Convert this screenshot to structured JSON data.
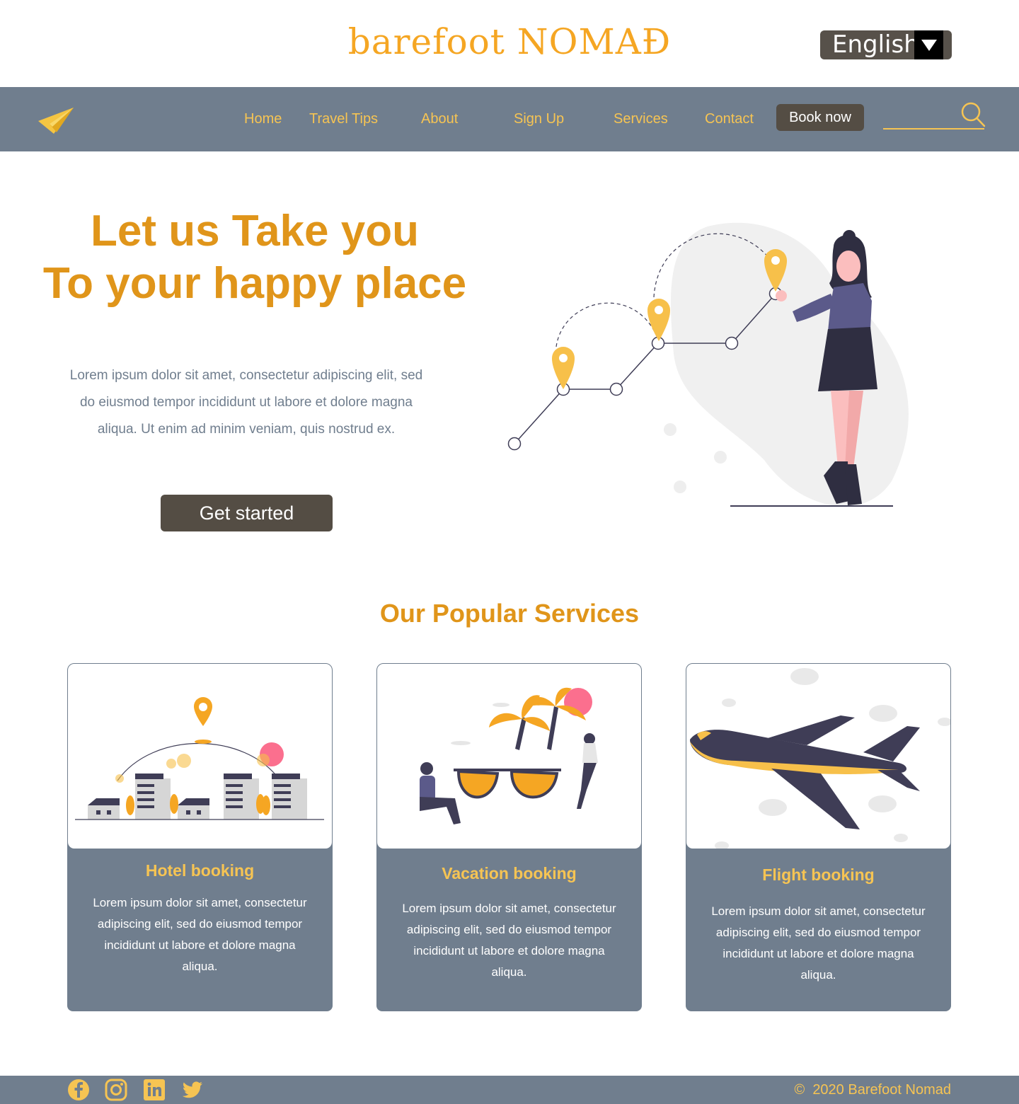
{
  "header": {
    "brand": "barefoot NOMAĐ",
    "language": "English"
  },
  "nav": {
    "links": [
      "Home",
      "Travel Tips",
      "About",
      "Sign Up",
      "Services",
      "Contact"
    ],
    "book_label": "Book now",
    "search_placeholder": ""
  },
  "hero": {
    "title_line1": "Let us Take you",
    "title_line2": "To your happy place",
    "text_line1": "Lorem ipsum dolor sit amet, consectetur adipiscing elit, sed",
    "text_line2": "do eiusmod tempor incididunt ut labore et dolore magna",
    "text_line3": "aliqua. Ut enim ad minim veniam, quis nostrud ex.",
    "cta_label": "Get started"
  },
  "services": {
    "title": "Our Popular Services",
    "cards": [
      {
        "title": "Hotel booking",
        "text": [
          "Lorem ipsum dolor sit amet, consectetur",
          "adipiscing elit, sed do eiusmod tempor",
          "incididunt ut labore et dolore magna",
          "aliqua."
        ]
      },
      {
        "title": "Vacation booking",
        "text": [
          "Lorem ipsum dolor sit amet, consectetur",
          "adipiscing elit, sed do eiusmod tempor",
          "incididunt ut labore et dolore magna",
          "aliqua."
        ]
      },
      {
        "title": "Flight booking",
        "text": [
          "Lorem ipsum dolor sit amet, consectetur",
          "adipiscing elit, sed do eiusmod tempor",
          "incididunt ut labore et dolore magna",
          "aliqua."
        ]
      }
    ]
  },
  "footer": {
    "copyright_symbol": "©",
    "copyright": "2020 Barefoot Nomad",
    "social_icons": [
      "facebook-icon",
      "instagram-icon",
      "linkedin-icon",
      "twitter-icon"
    ]
  },
  "colors": {
    "accent": "#f5a623",
    "heading": "#e0951a",
    "nav_bg": "#707e8e",
    "button_bg": "#544d44",
    "nav_text": "#f6c453"
  }
}
